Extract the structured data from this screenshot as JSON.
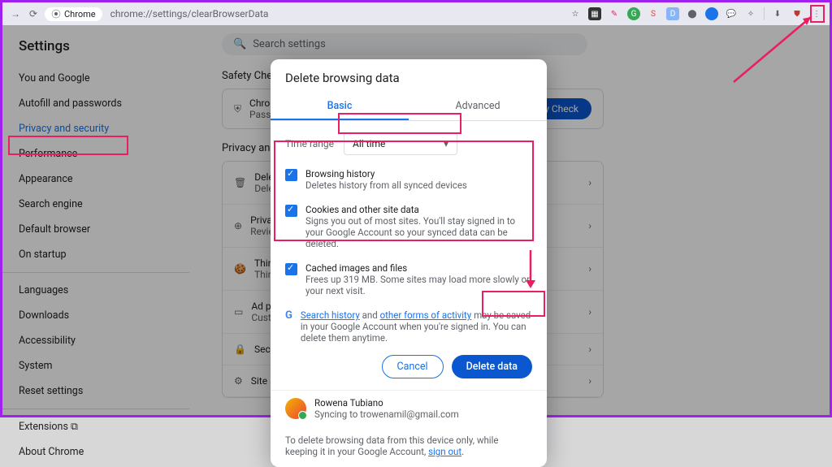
{
  "browser": {
    "product": "Chrome",
    "url": "chrome://settings/clearBrowserData"
  },
  "toolbar_icons": [
    "star",
    "menu-sq",
    "edit",
    "g-green",
    "s-red",
    "d-blue",
    "rec",
    "blue-circ",
    "chat",
    "puzzle",
    "sep",
    "download",
    "ublock",
    "more"
  ],
  "settings_title": "Settings",
  "sidebar": {
    "items": [
      {
        "label": "You and Google"
      },
      {
        "label": "Autofill and passwords"
      },
      {
        "label": "Privacy and security",
        "active": true
      },
      {
        "label": "Performance"
      },
      {
        "label": "Appearance"
      },
      {
        "label": "Search engine"
      },
      {
        "label": "Default browser"
      },
      {
        "label": "On startup"
      }
    ],
    "items2": [
      {
        "label": "Languages"
      },
      {
        "label": "Downloads"
      },
      {
        "label": "Accessibility"
      },
      {
        "label": "System"
      },
      {
        "label": "Reset settings"
      }
    ],
    "items3": [
      {
        "label": "Extensions"
      },
      {
        "label": "About Chrome"
      }
    ]
  },
  "search": {
    "placeholder": "Search settings"
  },
  "safety": {
    "section": "Safety Check",
    "card_title": "Chrome",
    "card_sub": "Passwords",
    "button": "Safety Check",
    "section2": "Privacy and security",
    "rows": [
      {
        "t": "Delete browsing data",
        "s": "Delete"
      },
      {
        "t": "Privacy",
        "s": "Review"
      },
      {
        "t": "Third-party",
        "s": "Third"
      },
      {
        "t": "Ad privacy",
        "s": "Customize"
      },
      {
        "t": "Security",
        "s": ""
      },
      {
        "t": "Site settings",
        "s": ""
      }
    ]
  },
  "dialog": {
    "title": "Delete browsing data",
    "tabs": {
      "basic": "Basic",
      "advanced": "Advanced"
    },
    "time_label": "Time range",
    "time_value": "All time",
    "checks": [
      {
        "t": "Browsing history",
        "s": "Deletes history from all synced devices"
      },
      {
        "t": "Cookies and other site data",
        "s": "Signs you out of most sites. You'll stay signed in to your Google Account so your synced data can be deleted."
      },
      {
        "t": "Cached images and files",
        "s": "Frees up 319 MB. Some sites may load more slowly on your next visit."
      }
    ],
    "google_note_pre": " ",
    "link1": "Search history",
    "mid": " and ",
    "link2": "other forms of activity",
    "google_note_post": " may be saved in your Google Account when you're signed in. You can delete them anytime.",
    "cancel": "Cancel",
    "delete": "Delete data",
    "user_name": "Rowena Tubiano",
    "user_sync": "Syncing to trowenamil@gmail.com",
    "device_note": "To delete browsing data from this device only, while keeping it in your Google Account, ",
    "signout": "sign out"
  }
}
